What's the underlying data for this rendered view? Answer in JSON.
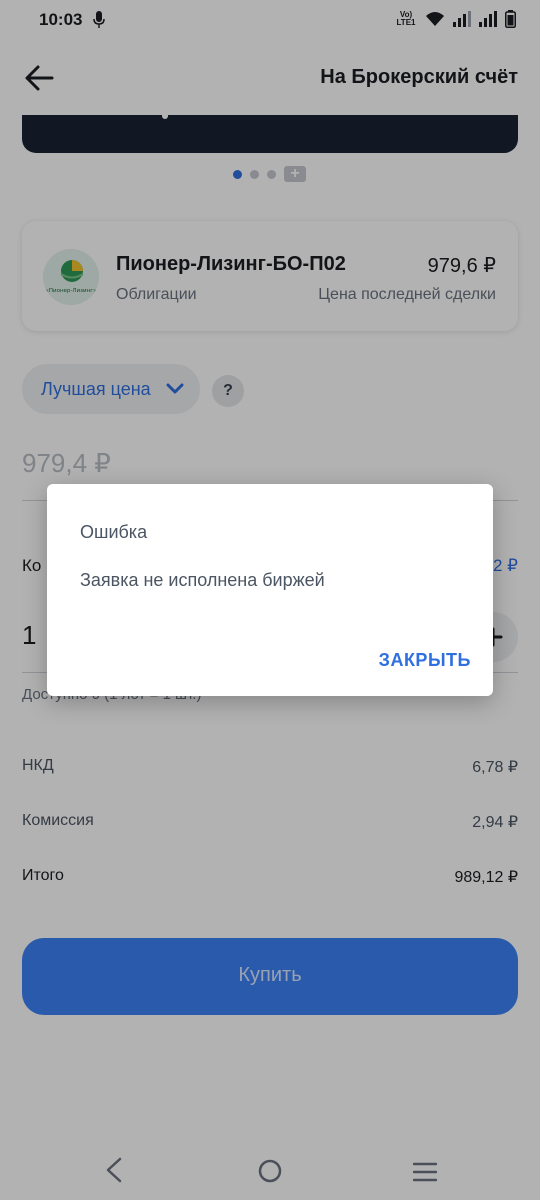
{
  "status_bar": {
    "time": "10:03",
    "network_label": "Vo) LTE1"
  },
  "header": {
    "link_text": "На Брокерский счёт"
  },
  "instrument": {
    "name": "Пионер-Лизинг-БО-П02",
    "type": "Облигации",
    "price": "979,6 ₽",
    "price_label": "Цена последней сделки",
    "logo_text": "«Пионер-Лизинг»"
  },
  "order": {
    "price_type": "Лучшая цена",
    "help": "?",
    "price_value": "979,4 ₽",
    "quantity_label": "Ко",
    "quantity_right": "2 ₽",
    "quantity_value": "1",
    "available": "Доступно 0 (1 лот = 1 шт.)"
  },
  "summary": {
    "nkd_label": "НКД",
    "nkd_value": "6,78 ₽",
    "fee_label": "Комиссия",
    "fee_value": "2,94 ₽",
    "total_label": "Итого",
    "total_value": "989,12 ₽"
  },
  "buy_button": {
    "label": "Купить"
  },
  "dialog": {
    "title": "Ошибка",
    "message": "Заявка не исполнена биржей",
    "close_label": "ЗАКРЫТЬ"
  },
  "colors": {
    "accent": "#2f6fe0",
    "buy_button": "#3b82f6",
    "scrim": "rgba(0,0,0,0.30)"
  }
}
